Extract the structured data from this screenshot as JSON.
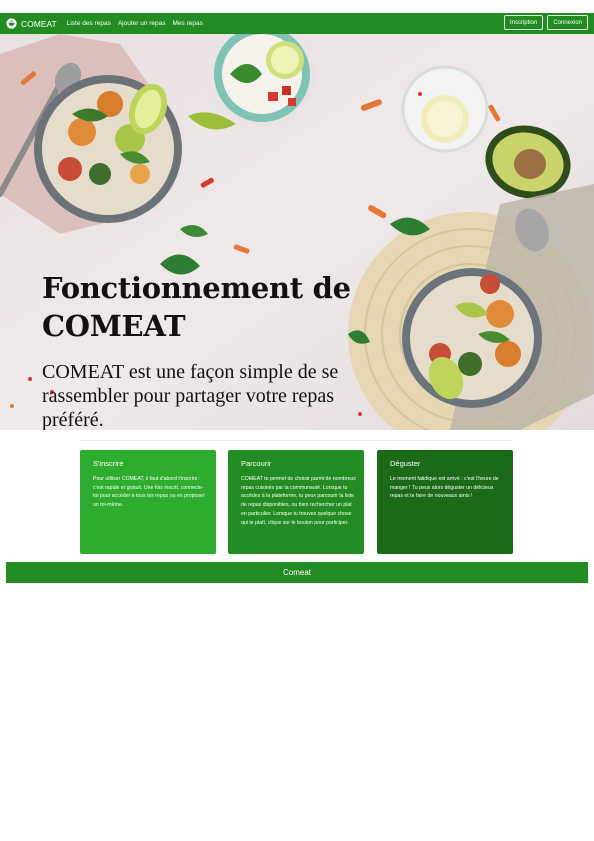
{
  "navbar": {
    "brand": "COMEAT",
    "links": [
      "Liste des repas",
      "Ajouter un repas",
      "Mes repas"
    ],
    "buttons": [
      "Inscription",
      "Connexion"
    ]
  },
  "hero": {
    "title": "Fonctionnement de COMEAT",
    "subtitle": "COMEAT est une façon simple de se rassembler pour partager votre repas préféré."
  },
  "cards": [
    {
      "title": "S'inscrire",
      "text": "Pour utiliser COMEAT, il faut d'abord t'inscrire : c'est rapide et gratuit. Une fois inscrit, connecte-toi pour accéder à tous les repas ou en proposer un toi-même.",
      "color": "#2eac2e"
    },
    {
      "title": "Parcourir",
      "text": "COMEAT te permet de choisir parmi de nombreux repas cuisinés par la communauté. Lorsque tu accèdes à la plateforme, tu peux parcourir la liste de repas disponibles, ou bien rechercher un plat en particulier. Lorsque tu trouves quelque chose qui te plaît, clique sur le bouton pour participer.",
      "color": "#228b22"
    },
    {
      "title": "Déguster",
      "text": "Le moment fatidique est arrivé : c'est l'heure de manger ! Tu peux alors déguster un délicieux repas et te faire de nouveaux amis !",
      "color": "#1a6a1a"
    }
  ],
  "footer": {
    "text": "Comeat"
  },
  "colors": {
    "primary": "#228b22",
    "light": "#2eac2e",
    "dark": "#1a6a1a"
  },
  "icons": {
    "brand": "food-bowl-icon"
  }
}
